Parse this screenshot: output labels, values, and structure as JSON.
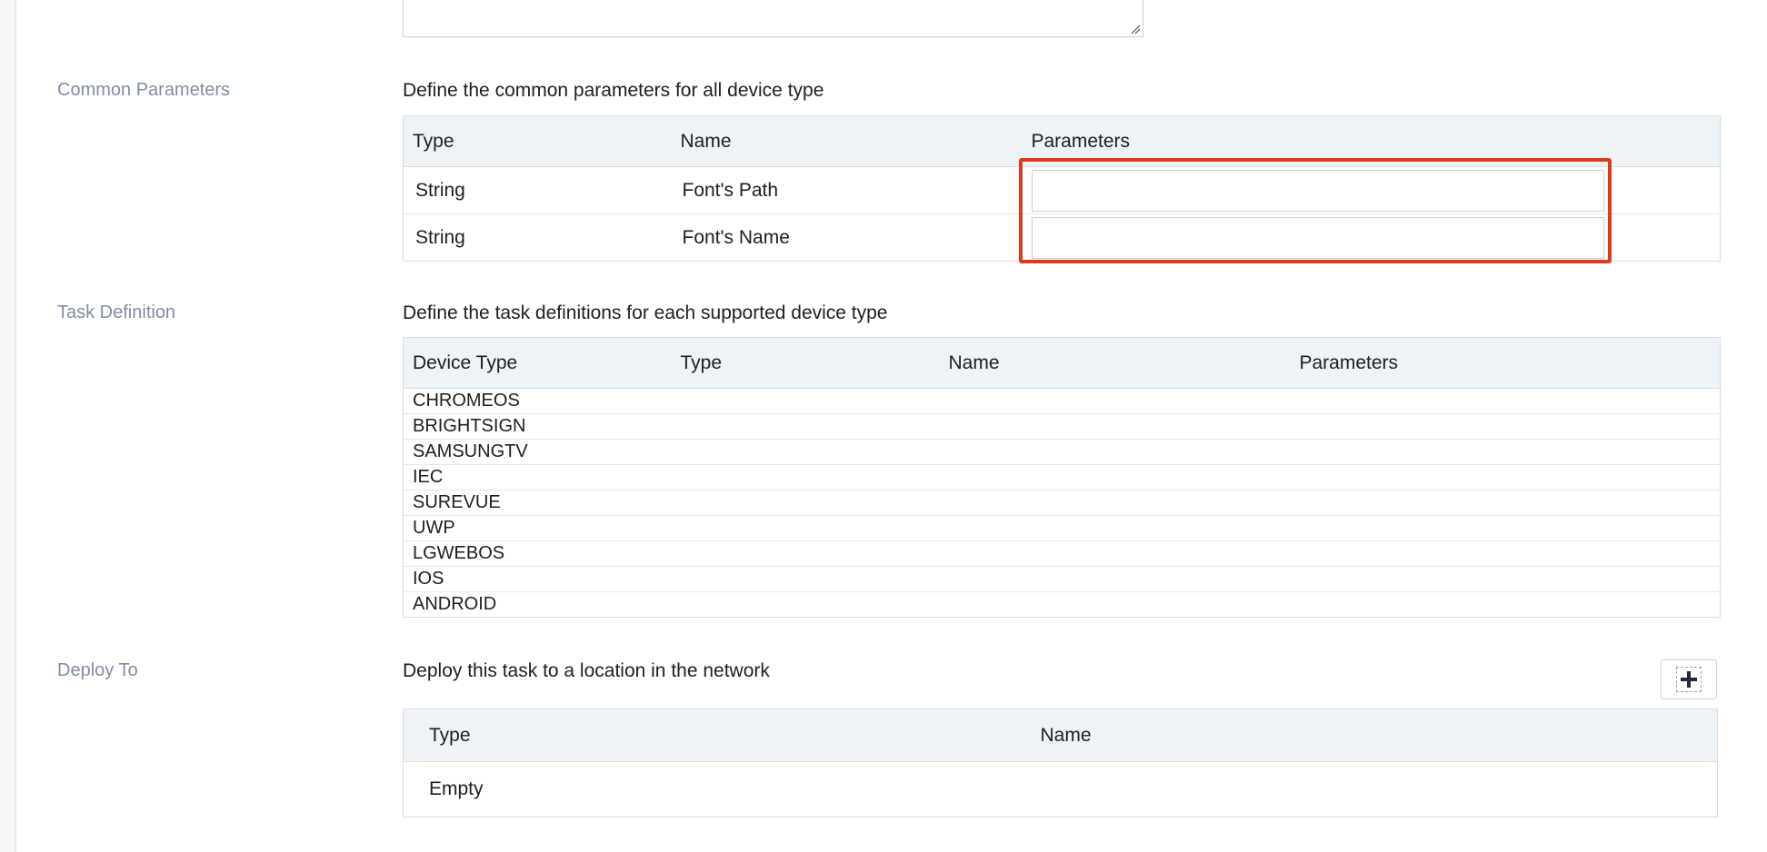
{
  "common_parameters": {
    "label": "Common Parameters",
    "description": "Define the common parameters for all device type",
    "columns": [
      "Type",
      "Name",
      "Parameters"
    ],
    "rows": [
      {
        "type": "String",
        "name": "Font's Path",
        "value": ""
      },
      {
        "type": "String",
        "name": "Font's Name",
        "value": ""
      }
    ]
  },
  "task_definition": {
    "label": "Task Definition",
    "description": "Define the task definitions for each supported device type",
    "columns": [
      "Device Type",
      "Type",
      "Name",
      "Parameters"
    ],
    "rows": [
      "CHROMEOS",
      "BRIGHTSIGN",
      "SAMSUNGTV",
      "IEC",
      "SUREVUE",
      "UWP",
      "LGWEBOS",
      "IOS",
      "ANDROID"
    ]
  },
  "deploy_to": {
    "label": "Deploy To",
    "description": "Deploy this task to a location in the network",
    "columns": [
      "Type",
      "Name"
    ],
    "empty_text": "Empty",
    "add_icon": "plus-icon"
  },
  "colors": {
    "highlight": "#e03a1e",
    "header_bg": "#eef3f8",
    "section_label": "#7f8ea3"
  }
}
